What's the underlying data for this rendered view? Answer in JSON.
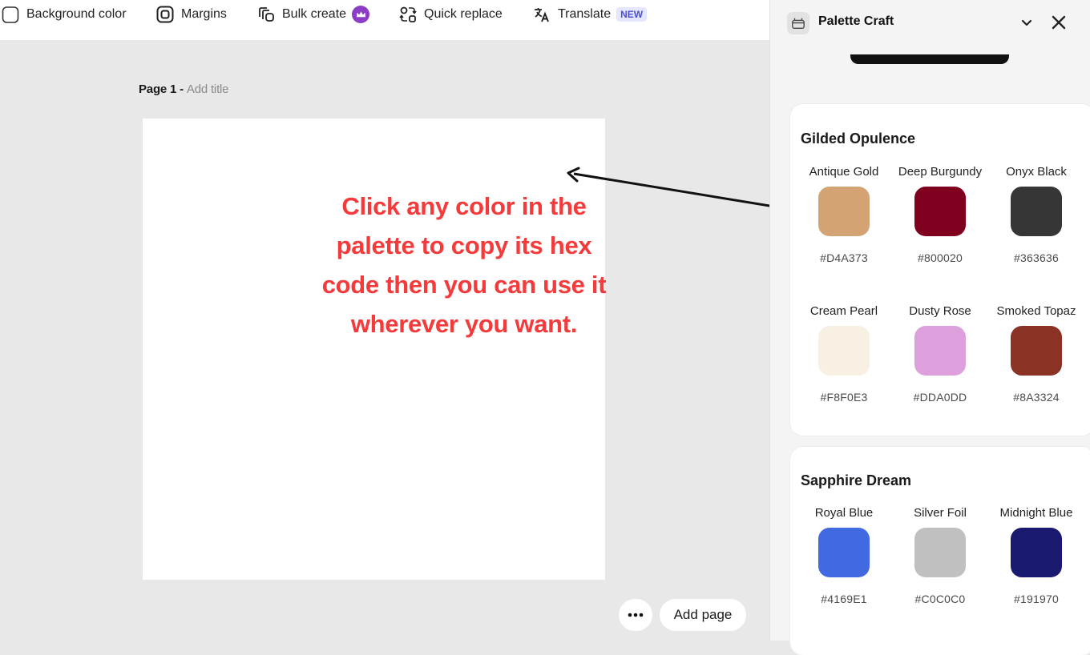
{
  "toolbar": {
    "items": [
      {
        "label": "Background color",
        "icon": "checkbox-icon"
      },
      {
        "label": "Margins",
        "icon": "margins-icon"
      },
      {
        "label": "Bulk create",
        "icon": "bulk-create-icon"
      },
      {
        "label": "Quick replace",
        "icon": "quick-replace-icon"
      },
      {
        "label": "Translate",
        "icon": "translate-icon",
        "badge": "NEW"
      }
    ]
  },
  "canvas": {
    "page_label": "Page 1 - ",
    "add_title": "Add title",
    "annotation_line1": "Click any color in the",
    "annotation_line2": "palette to copy its hex",
    "annotation_line3": "code then you can use it",
    "annotation_line4": "wherever you want.",
    "annotation_color": "#F43A3A",
    "more_icon": "more-dots-icon",
    "add_page_label": "Add page"
  },
  "panel": {
    "title": "Palette Craft",
    "palettes": [
      {
        "name": "Gilded Opulence",
        "colors": [
          {
            "name": "Antique Gold",
            "hex": "#D4A373"
          },
          {
            "name": "Deep Burgundy",
            "hex": "#800020"
          },
          {
            "name": "Onyx Black",
            "hex": "#363636"
          },
          {
            "name": "Cream Pearl",
            "hex": "#F8F0E3"
          },
          {
            "name": "Dusty Rose",
            "hex": "#DDA0DD"
          },
          {
            "name": "Smoked Topaz",
            "hex": "#8A3324"
          }
        ]
      },
      {
        "name": "Sapphire Dream",
        "colors": [
          {
            "name": "Royal Blue",
            "hex": "#4169E1"
          },
          {
            "name": "Silver Foil",
            "hex": "#C0C0C0"
          },
          {
            "name": "Midnight Blue",
            "hex": "#191970"
          }
        ]
      }
    ]
  },
  "colors": {
    "accent_new_badge": "#4B4FD6",
    "premium_crown": "#8B3DC5"
  }
}
